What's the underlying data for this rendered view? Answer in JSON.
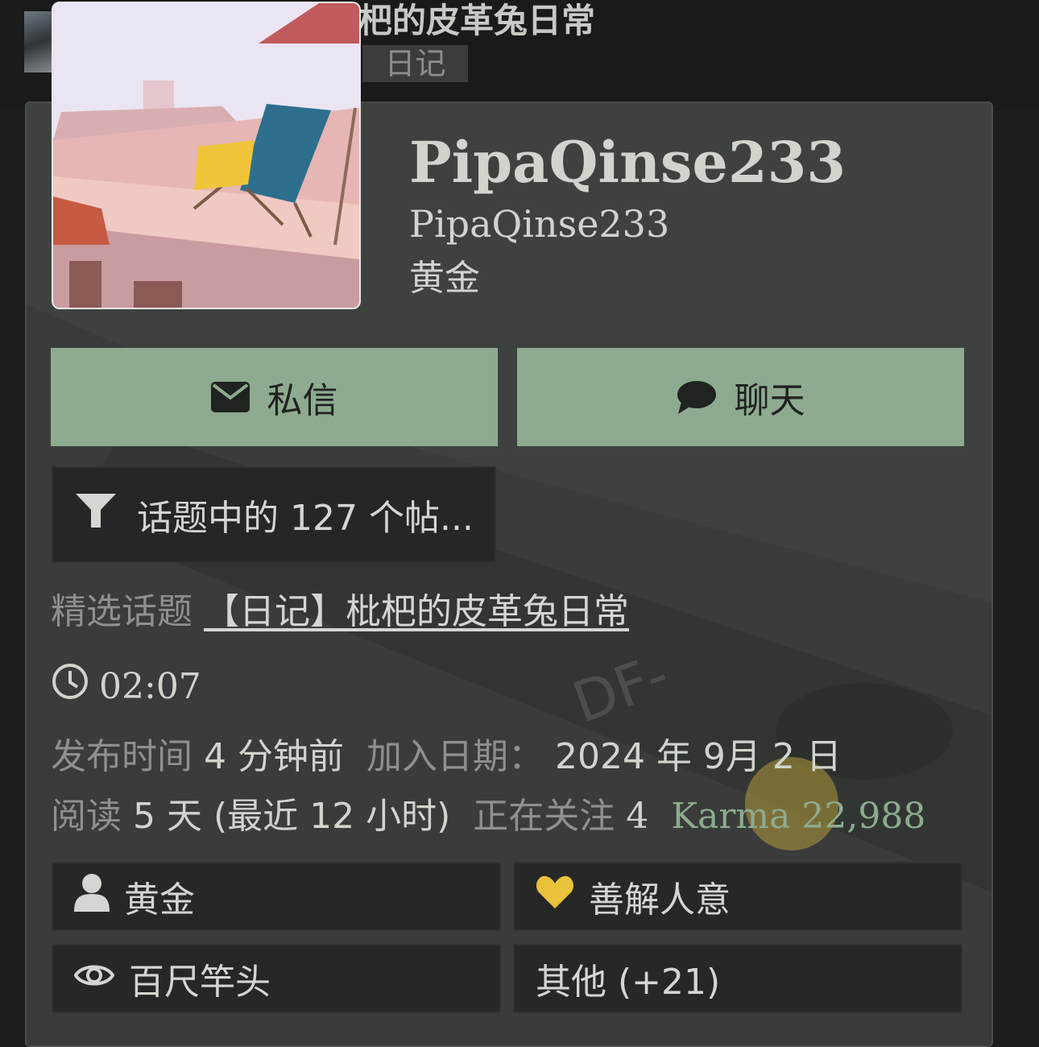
{
  "header": {
    "topic_title": "杷的皮革兔日常",
    "topic_tag": "日记"
  },
  "profile": {
    "display_name": "PipaQinse233",
    "username": "PipaQinse233",
    "title": "黄金"
  },
  "actions": {
    "message_label": "私信",
    "chat_label": "聊天",
    "filter_label": "话题中的 127 个帖..."
  },
  "featured": {
    "label": "精选话题",
    "link": "【日记】枇杷的皮革兔日常"
  },
  "local_time": "02:07",
  "stats": {
    "posted_label": "发布时间",
    "posted_value": "4 分钟前",
    "joined_label": "加入日期：",
    "joined_value": "2024 年 9月 2 日",
    "read_label": "阅读",
    "read_value": "5 天 (最近 12 小时)",
    "following_label": "正在关注",
    "following_value": "4",
    "karma_label": "Karma",
    "karma_value": "22,988"
  },
  "badges": [
    {
      "label": "黄金",
      "icon": "user-icon"
    },
    {
      "label": "善解人意",
      "icon": "heart-icon",
      "color": "#e8c23a"
    },
    {
      "label": "百尺竿头",
      "icon": "eye-icon"
    },
    {
      "label": "其他 (+21)",
      "icon": ""
    }
  ],
  "colors": {
    "accent": "#8eab8f",
    "card": "#3e423f"
  }
}
